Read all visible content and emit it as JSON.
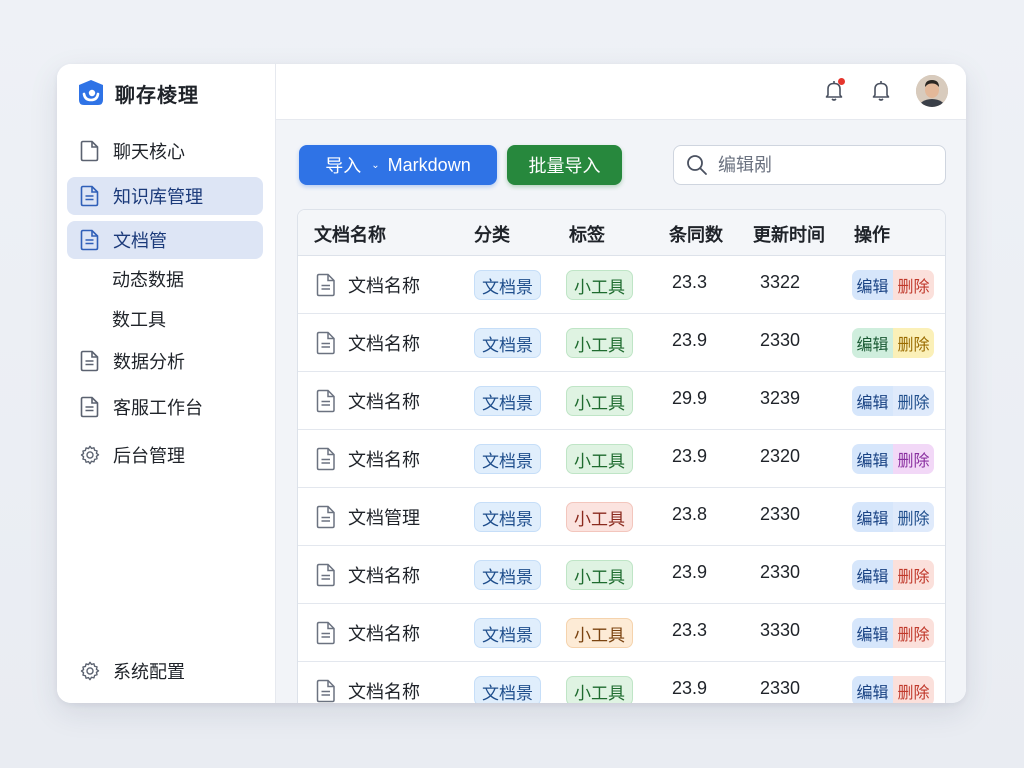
{
  "app": {
    "title": "聊存棱理"
  },
  "sidebar": {
    "items": [
      {
        "label": "聊天核心",
        "icon": "file-icon"
      },
      {
        "label": "知识库管理",
        "icon": "file-text-icon",
        "active": true
      },
      {
        "label": "文档管",
        "icon": "file-text-icon",
        "active": true
      },
      {
        "label": "数据分析",
        "icon": "file-text-icon"
      },
      {
        "label": "客服工作台",
        "icon": "file-text-icon"
      },
      {
        "label": "后台管理",
        "icon": "gear-icon"
      }
    ],
    "sub_items": [
      {
        "label": "动态数据"
      },
      {
        "label": "数工具"
      }
    ],
    "footer": {
      "label": "系统配置",
      "icon": "gear-icon"
    }
  },
  "header": {
    "notification_badge_color": "#e5352d"
  },
  "toolbar": {
    "import_label": "导入",
    "import_format": "Markdown",
    "batch_import_label": "批量导入",
    "search_placeholder": "编辑剐"
  },
  "colors": {
    "primary": "#2f73e6",
    "success": "#27883d",
    "active_nav_bg": "#dde5f5"
  },
  "table": {
    "columns": [
      "文档名称",
      "分类",
      "标签",
      "条同数",
      "更新时间",
      "操作"
    ],
    "rows": [
      {
        "name": "文档名称",
        "category": "文档景",
        "tag": "小工具",
        "tag_color": "green",
        "count": "23.3",
        "updated": "3322",
        "edit": "编辑",
        "delete": "删除",
        "delete_color": "red"
      },
      {
        "name": "文档名称",
        "category": "文档景",
        "tag": "小工具",
        "tag_color": "green",
        "count": "23.9",
        "updated": "2330",
        "edit": "编辑",
        "delete": "删除",
        "delete_color": "yellow"
      },
      {
        "name": "文档名称",
        "category": "文档景",
        "tag": "小工具",
        "tag_color": "green",
        "count": "29.9",
        "updated": "3239",
        "edit": "编辑",
        "delete": "删除",
        "delete_color": "blue"
      },
      {
        "name": "文档名称",
        "category": "文档景",
        "tag": "小工具",
        "tag_color": "green",
        "count": "23.9",
        "updated": "2320",
        "edit": "编辑",
        "delete": "删除",
        "delete_color": "purple"
      },
      {
        "name": "文档管理",
        "category": "文档景",
        "tag": "小工具",
        "tag_color": "red",
        "count": "23.8",
        "updated": "2330",
        "edit": "编辑",
        "delete": "删除",
        "delete_color": "blue"
      },
      {
        "name": "文档名称",
        "category": "文档景",
        "tag": "小工具",
        "tag_color": "green",
        "count": "23.9",
        "updated": "2330",
        "edit": "编辑",
        "delete": "删除",
        "delete_color": "red"
      },
      {
        "name": "文档名称",
        "category": "文档景",
        "tag": "小工具",
        "tag_color": "orange",
        "count": "23.3",
        "updated": "3330",
        "edit": "编辑",
        "delete": "删除",
        "delete_color": "red"
      },
      {
        "name": "文档名称",
        "category": "文档景",
        "tag": "小工具",
        "tag_color": "green",
        "count": "23.9",
        "updated": "2330",
        "edit": "编辑",
        "delete": "删除",
        "delete_color": "red"
      }
    ]
  }
}
